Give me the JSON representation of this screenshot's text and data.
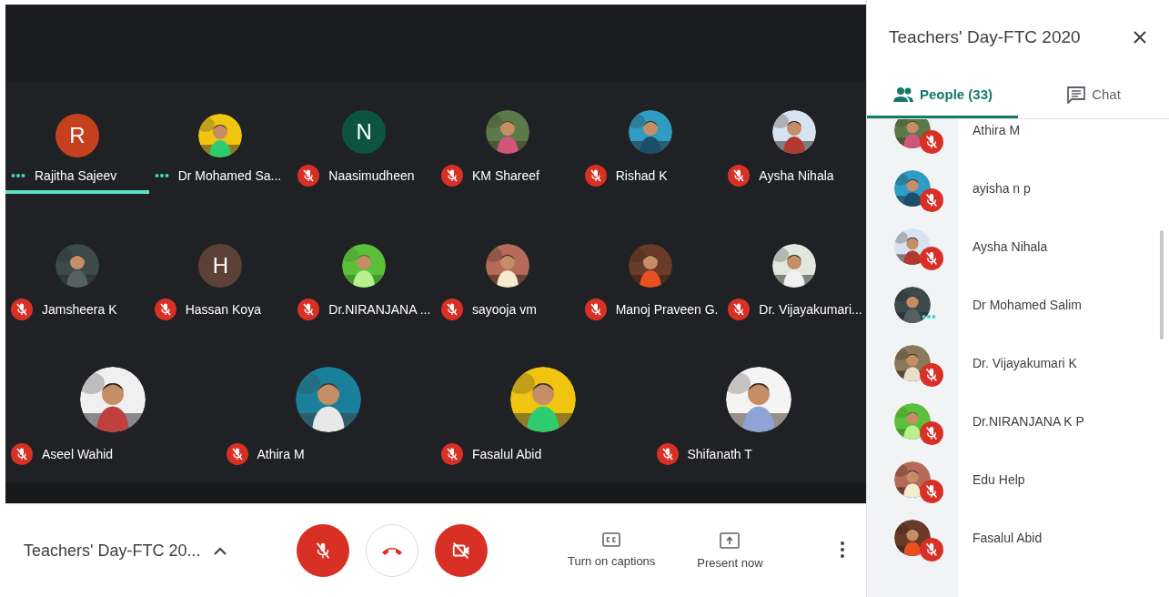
{
  "stage": {
    "grid_tiles": [
      {
        "name": "Rajitha Sajeev",
        "avatar": {
          "kind": "letter",
          "letter": "R",
          "color": "#c5401d"
        },
        "muted": false,
        "highlighted": true
      },
      {
        "name": "Dr Mohamed Sa...",
        "muted": false,
        "highlighted": false
      },
      {
        "name": "Naasimudheen",
        "avatar": {
          "kind": "letter",
          "letter": "N",
          "color": "#0c5442"
        },
        "muted": true,
        "highlighted": false
      },
      {
        "name": "KM Shareef",
        "muted": true,
        "highlighted": false
      },
      {
        "name": "Rishad K",
        "muted": true,
        "highlighted": false
      },
      {
        "name": "Aysha Nihala",
        "muted": true,
        "highlighted": false
      },
      {
        "name": "Jamsheera K",
        "muted": true,
        "highlighted": false
      },
      {
        "name": "Hassan Koya",
        "avatar": {
          "kind": "letter",
          "letter": "H",
          "color": "#5d4037"
        },
        "muted": true,
        "highlighted": false
      },
      {
        "name": "Dr.NIRANJANA ...",
        "muted": true,
        "highlighted": false
      },
      {
        "name": "sayooja vm",
        "muted": true,
        "highlighted": false
      },
      {
        "name": "Manoj Praveen G.",
        "muted": true,
        "highlighted": false
      },
      {
        "name": "Dr. Vijayakumari...",
        "muted": true,
        "highlighted": false
      }
    ],
    "wide_tiles": [
      {
        "name": "Aseel Wahid",
        "muted": true,
        "highlighted": false
      },
      {
        "name": "Athira M",
        "muted": true,
        "highlighted": false
      },
      {
        "name": "Fasalul Abid",
        "muted": true,
        "highlighted": false
      },
      {
        "name": "Shifanath T",
        "muted": true,
        "highlighted": false
      }
    ]
  },
  "control_bar": {
    "meeting_title": "Teachers' Day-FTC 20...",
    "mic_on": false,
    "camera_on": false,
    "actions": [
      {
        "kind": "captions",
        "label": "Turn on captions"
      },
      {
        "kind": "present",
        "label": "Present now"
      }
    ]
  },
  "side_panel": {
    "title": "Teachers' Day-FTC 2020",
    "tabs": [
      {
        "kind": "people",
        "label": "People (33)",
        "selected": true
      },
      {
        "kind": "chat",
        "label": "Chat",
        "selected": false
      }
    ],
    "people": [
      {
        "name": "Athira M",
        "muted": true
      },
      {
        "name": "ayisha n p",
        "muted": true
      },
      {
        "name": "Aysha Nihala",
        "muted": true
      },
      {
        "name": "Dr Mohamed Salim",
        "muted": false
      },
      {
        "name": "Dr. Vijayakumari K",
        "muted": true
      },
      {
        "name": "Dr.NIRANJANA K P",
        "muted": true
      },
      {
        "name": "Edu Help",
        "muted": true
      },
      {
        "name": "Fasalul Abid",
        "muted": true
      }
    ]
  }
}
